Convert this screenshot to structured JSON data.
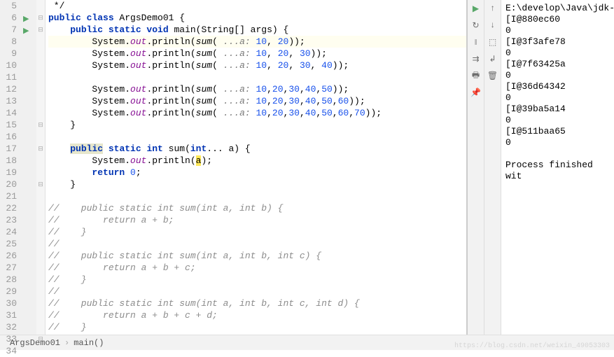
{
  "code": {
    "lines": [
      {
        "n": 5,
        "mark": "",
        "fold": "",
        "hl": false,
        "html": " */"
      },
      {
        "n": 6,
        "mark": "run",
        "fold": "-",
        "hl": false,
        "html": "<span class='kw'>public class</span> ArgsDemo01 {"
      },
      {
        "n": 7,
        "mark": "run",
        "fold": "-",
        "hl": false,
        "html": "    <span class='kw'>public static void</span> main(String[] args) {"
      },
      {
        "n": 8,
        "mark": "",
        "fold": "",
        "hl": true,
        "html": "        System.<span class='field'>out</span>.println(<span class='method-i'>sum</span>( <span class='str-lbl'>...a:</span> <span class='num'>10</span>, <span class='num'>20</span>));"
      },
      {
        "n": 9,
        "mark": "",
        "fold": "",
        "hl": false,
        "html": "        System.<span class='field'>out</span>.println(<span class='method-i'>sum</span>( <span class='str-lbl'>...a:</span> <span class='num'>10</span>, <span class='num'>20</span>, <span class='num'>30</span>));"
      },
      {
        "n": 10,
        "mark": "",
        "fold": "",
        "hl": false,
        "html": "        System.<span class='field'>out</span>.println(<span class='method-i'>sum</span>( <span class='str-lbl'>...a:</span> <span class='num'>10</span>, <span class='num'>20</span>, <span class='num'>30</span>, <span class='num'>40</span>));"
      },
      {
        "n": 11,
        "mark": "",
        "fold": "",
        "hl": false,
        "html": ""
      },
      {
        "n": 12,
        "mark": "",
        "fold": "",
        "hl": false,
        "html": "        System.<span class='field'>out</span>.println(<span class='method-i'>sum</span>( <span class='str-lbl'>...a:</span> <span class='num'>10</span>,<span class='num'>20</span>,<span class='num'>30</span>,<span class='num'>40</span>,<span class='num'>50</span>));"
      },
      {
        "n": 13,
        "mark": "",
        "fold": "",
        "hl": false,
        "html": "        System.<span class='field'>out</span>.println(<span class='method-i'>sum</span>( <span class='str-lbl'>...a:</span> <span class='num'>10</span>,<span class='num'>20</span>,<span class='num'>30</span>,<span class='num'>40</span>,<span class='num'>50</span>,<span class='num'>60</span>));"
      },
      {
        "n": 14,
        "mark": "",
        "fold": "",
        "hl": false,
        "html": "        System.<span class='field'>out</span>.println(<span class='method-i'>sum</span>( <span class='str-lbl'>...a:</span> <span class='num'>10</span>,<span class='num'>20</span>,<span class='num'>30</span>,<span class='num'>40</span>,<span class='num'>50</span>,<span class='num'>60</span>,<span class='num'>70</span>));"
      },
      {
        "n": 15,
        "mark": "",
        "fold": "-",
        "hl": false,
        "html": "    }"
      },
      {
        "n": 16,
        "mark": "",
        "fold": "",
        "hl": false,
        "html": ""
      },
      {
        "n": 17,
        "mark": "",
        "fold": "-",
        "hl": false,
        "html": "    <span class='hl-box'><span class='kw'>public</span></span> <span class='kw'>static int</span> sum(<span class='kw'>int</span>... a) {"
      },
      {
        "n": 18,
        "mark": "",
        "fold": "",
        "hl": false,
        "html": "        System.<span class='field'>out</span>.println(<span class='hl-y'>a</span>);"
      },
      {
        "n": 19,
        "mark": "",
        "fold": "",
        "hl": false,
        "html": "        <span class='kw'>return</span> <span class='num'>0</span>;"
      },
      {
        "n": 20,
        "mark": "",
        "fold": "-",
        "hl": false,
        "html": "    }"
      },
      {
        "n": 21,
        "mark": "",
        "fold": "",
        "hl": false,
        "html": ""
      },
      {
        "n": 22,
        "mark": "",
        "fold": "",
        "hl": false,
        "html": "<span class='cmt'>//    public static int sum(int a, int b) {</span>"
      },
      {
        "n": 23,
        "mark": "",
        "fold": "",
        "hl": false,
        "html": "<span class='cmt'>//        return a + b;</span>"
      },
      {
        "n": 24,
        "mark": "",
        "fold": "",
        "hl": false,
        "html": "<span class='cmt'>//    }</span>"
      },
      {
        "n": 25,
        "mark": "",
        "fold": "",
        "hl": false,
        "html": "<span class='cmt'>//</span>"
      },
      {
        "n": 26,
        "mark": "",
        "fold": "",
        "hl": false,
        "html": "<span class='cmt'>//    public static int sum(int a, int b, int c) {</span>"
      },
      {
        "n": 27,
        "mark": "",
        "fold": "",
        "hl": false,
        "html": "<span class='cmt'>//        return a + b + c;</span>"
      },
      {
        "n": 28,
        "mark": "",
        "fold": "",
        "hl": false,
        "html": "<span class='cmt'>//    }</span>"
      },
      {
        "n": 29,
        "mark": "",
        "fold": "",
        "hl": false,
        "html": "<span class='cmt'>//</span>"
      },
      {
        "n": 30,
        "mark": "",
        "fold": "",
        "hl": false,
        "html": "<span class='cmt'>//    public static int sum(int a, int b, int c, int d) {</span>"
      },
      {
        "n": 31,
        "mark": "",
        "fold": "",
        "hl": false,
        "html": "<span class='cmt'>//        return a + b + c + d;</span>"
      },
      {
        "n": 32,
        "mark": "",
        "fold": "",
        "hl": false,
        "html": "<span class='cmt'>//    }</span>"
      },
      {
        "n": 33,
        "mark": "",
        "fold": "-",
        "hl": false,
        "html": "}"
      },
      {
        "n": 34,
        "mark": "",
        "fold": "",
        "hl": false,
        "html": ""
      }
    ]
  },
  "console": {
    "header": "E:\\develop\\Java\\jdk-",
    "out": [
      "[I@880ec60",
      "0",
      "[I@3f3afe78",
      "0",
      "[I@7f63425a",
      "0",
      "[I@36d64342",
      "0",
      "[I@39ba5a14",
      "0",
      "[I@511baa65",
      "0",
      "",
      "Process finished wit"
    ]
  },
  "toolbar": {
    "icons": [
      "run",
      "stop",
      "rerun",
      "down",
      "stack",
      "layout",
      "print",
      "pin",
      "trash"
    ]
  },
  "breadcrumb": {
    "class": "ArgsDemo01",
    "method": "main()"
  },
  "watermark": "https://blog.csdn.net/weixin_49053303"
}
